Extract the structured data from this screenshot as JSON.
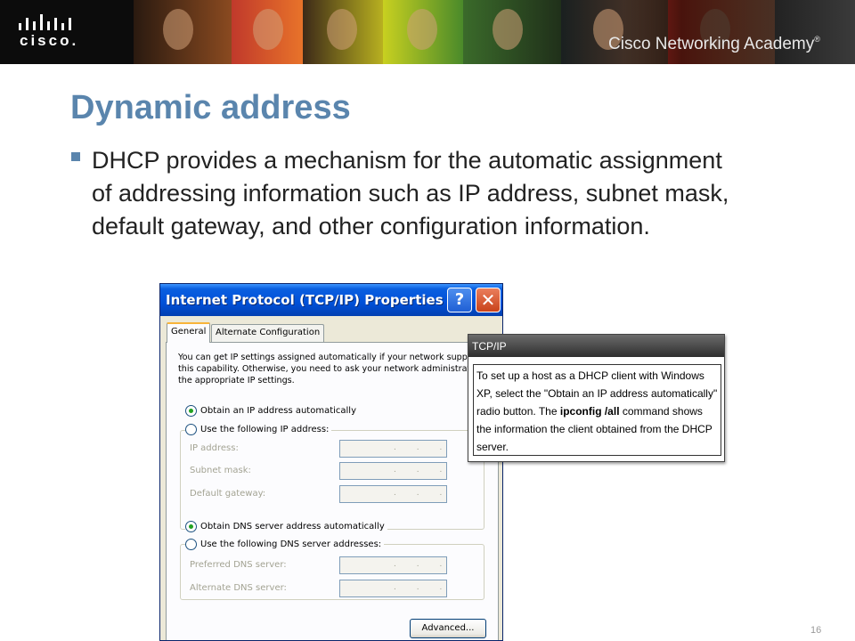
{
  "banner": {
    "logo_text": "cisco.",
    "academy_text": "Cisco Networking Academy",
    "trademark": "®"
  },
  "slide": {
    "title": "Dynamic address",
    "bullet": "DHCP provides a mechanism for the automatic assignment of addressing information such as IP address, subnet mask, default gateway, and other configuration information.",
    "page_number": "16"
  },
  "dialog": {
    "title": "Internet Protocol (TCP/IP) Properties",
    "help_glyph": "?",
    "close_glyph": "✕",
    "tabs": [
      {
        "label": "General",
        "active": true
      },
      {
        "label": "Alternate Configuration",
        "active": false
      }
    ],
    "info_lines": [
      "You can get IP settings assigned automatically if your network supports",
      "this capability. Otherwise, you need to ask your network administrator fo",
      "the appropriate IP settings."
    ],
    "radio_ip_auto": "Obtain an IP address automatically",
    "radio_ip_manual": "Use the following IP address:",
    "ip_fields": [
      {
        "label": "IP address:",
        "dots": "..."
      },
      {
        "label": "Subnet mask:",
        "dots": "..."
      },
      {
        "label": "Default gateway:",
        "dots": "..."
      }
    ],
    "radio_dns_auto": "Obtain DNS server address automatically",
    "radio_dns_manual": "Use the following DNS server addresses:",
    "dns_fields": [
      {
        "label": "Preferred DNS server:",
        "dots": "..."
      },
      {
        "label": "Alternate DNS server:",
        "dots": "..."
      }
    ],
    "advanced_button": "Advanced..."
  },
  "callout": {
    "title": "TCP/IP",
    "text_1": "To set up a host as a DHCP client with Windows XP, select the \"Obtain an IP address automatically\" radio button. The",
    "command": "ipconfig /all",
    "text_2": "command shows the information the client obtained from the DHCP server."
  },
  "colors": {
    "title_blue": "#5a85ad",
    "xp_titlebar": "#0050d8",
    "dialog_face": "#ece9d8"
  }
}
